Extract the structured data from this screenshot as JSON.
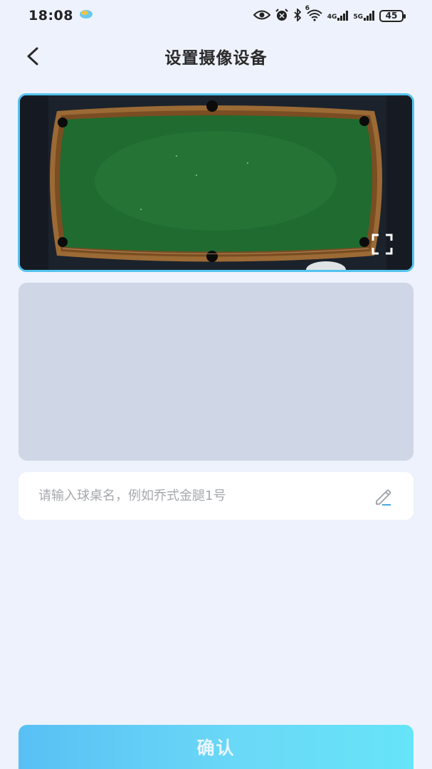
{
  "status_bar": {
    "time": "18:08",
    "network_4g": "4G",
    "network_5g": "5G",
    "wifi_badge": "6",
    "battery": "45",
    "icons": [
      "eye-icon",
      "alarm-icon",
      "bluetooth-icon",
      "wifi-icon",
      "signal-icon",
      "battery-icon"
    ]
  },
  "header": {
    "title": "设置摄像设备",
    "back_icon": "chevron-left-icon"
  },
  "video": {
    "fullscreen_icon": "fullscreen-icon"
  },
  "form": {
    "table_name_value": "",
    "table_name_placeholder": "请输入球桌名，例如乔式金腿1号",
    "edit_icon": "pencil-icon"
  },
  "footer": {
    "confirm_label": "确认"
  },
  "colors": {
    "background": "#eef2fc",
    "accent": "#54c3ee",
    "button_start": "#59c0f4",
    "button_end": "#66e4f8",
    "placeholder_panel": "#cfd6e6"
  }
}
